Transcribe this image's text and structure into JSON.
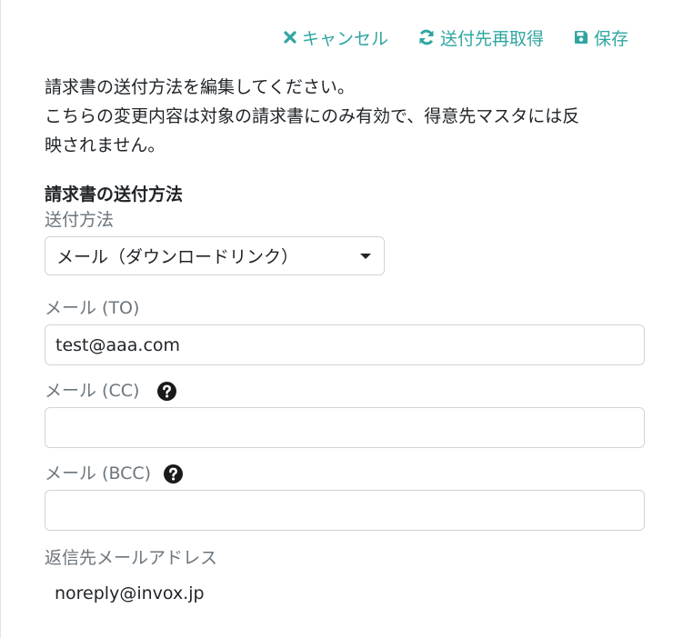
{
  "toolbar": {
    "cancel_label": "キャンセル",
    "refetch_label": "送付先再取得",
    "save_label": "保存",
    "accent_color": "#2fa6a0",
    "icons": {
      "cancel": "close-icon",
      "refetch": "refresh-icon",
      "save": "floppy-disk-icon"
    }
  },
  "description": {
    "line1": "請求書の送付方法を編集してください。",
    "line2": "こちらの変更内容は対象の請求書にのみ有効で、得意先マスタには反",
    "line3": "映されません。"
  },
  "section": {
    "title": "請求書の送付方法"
  },
  "send_method": {
    "label": "送付方法",
    "selected": "メール（ダウンロードリンク）"
  },
  "mail_to": {
    "label": "メール (TO)",
    "value": "test@aaa.com"
  },
  "mail_cc": {
    "label": "メール (CC)",
    "value": "",
    "help_icon": "question-circle-icon"
  },
  "mail_bcc": {
    "label": "メール (BCC)",
    "value": "",
    "help_icon": "question-circle-icon"
  },
  "reply_to": {
    "label": "返信先メールアドレス",
    "value": "noreply@invox.jp"
  }
}
